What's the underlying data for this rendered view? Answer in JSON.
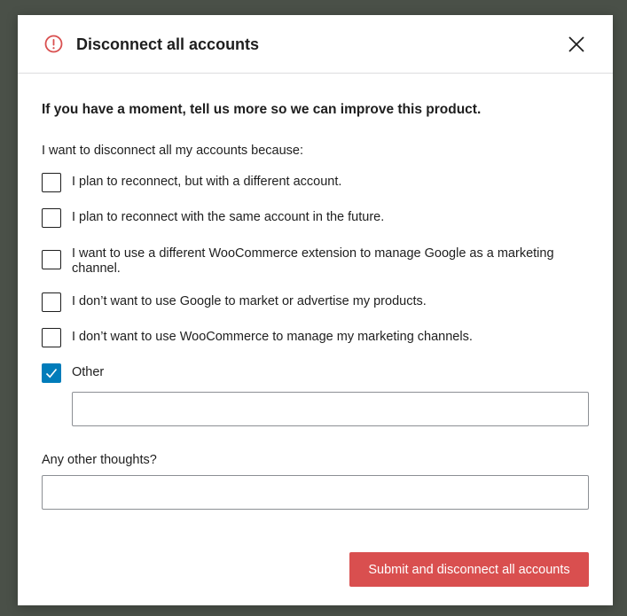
{
  "modal": {
    "title": "Disconnect all accounts",
    "icon": "alert-circle-icon",
    "close_icon": "close-icon"
  },
  "form": {
    "intro": "If you have a moment, tell us more so we can improve this product.",
    "prompt": "I want to disconnect all my accounts because:",
    "options": [
      {
        "label": "I plan to reconnect, but with a different account.",
        "checked": false
      },
      {
        "label": "I plan to reconnect with the same account in the future.",
        "checked": false
      },
      {
        "label": "I want to use a different WooCommerce extension to manage Google as a marketing channel.",
        "checked": false
      },
      {
        "label": "I don’t want to use Google to market or advertise my products.",
        "checked": false
      },
      {
        "label": "I don’t want to use WooCommerce to manage my marketing channels.",
        "checked": false
      },
      {
        "label": "Other",
        "checked": true
      }
    ],
    "other_input": {
      "value": ""
    },
    "thoughts_label": "Any other thoughts?",
    "thoughts_input": {
      "value": ""
    },
    "submit_label": "Submit and disconnect all accounts"
  },
  "colors": {
    "accent": "#007cba",
    "danger": "#d94f4f",
    "overlay": "#4a5048"
  }
}
